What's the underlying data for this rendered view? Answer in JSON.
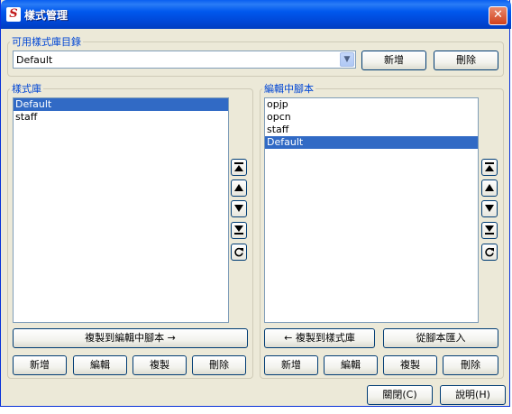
{
  "window": {
    "title": "樣式管理",
    "app_icon_glyph": "S",
    "close_glyph": "✕"
  },
  "library_catalog": {
    "legend": "可用樣式庫目錄",
    "selected": "Default",
    "new_button": "新增",
    "delete_button": "刪除"
  },
  "style_library": {
    "legend": "樣式庫",
    "items": [
      {
        "label": "Default",
        "selected": true
      },
      {
        "label": "staff",
        "selected": false
      }
    ],
    "copy_button": "複製到編輯中腳本 →",
    "new_button": "新增",
    "edit_button": "編輯",
    "duplicate_button": "複製",
    "delete_button": "刪除"
  },
  "editing_script": {
    "legend": "編輯中腳本",
    "items": [
      {
        "label": "opjp",
        "selected": false
      },
      {
        "label": "opcn",
        "selected": false
      },
      {
        "label": "staff",
        "selected": false
      },
      {
        "label": "Default",
        "selected": true
      }
    ],
    "copy_button": "← 複製到樣式庫",
    "import_button": "從腳本匯入",
    "new_button": "新增",
    "edit_button": "編輯",
    "duplicate_button": "複製",
    "delete_button": "刪除"
  },
  "order_buttons": [
    "move-top-icon",
    "move-up-icon",
    "move-down-icon",
    "move-bottom-icon",
    "refresh-icon"
  ],
  "footer": {
    "close_button": "關閉(C)",
    "help_button": "說明(H)"
  }
}
